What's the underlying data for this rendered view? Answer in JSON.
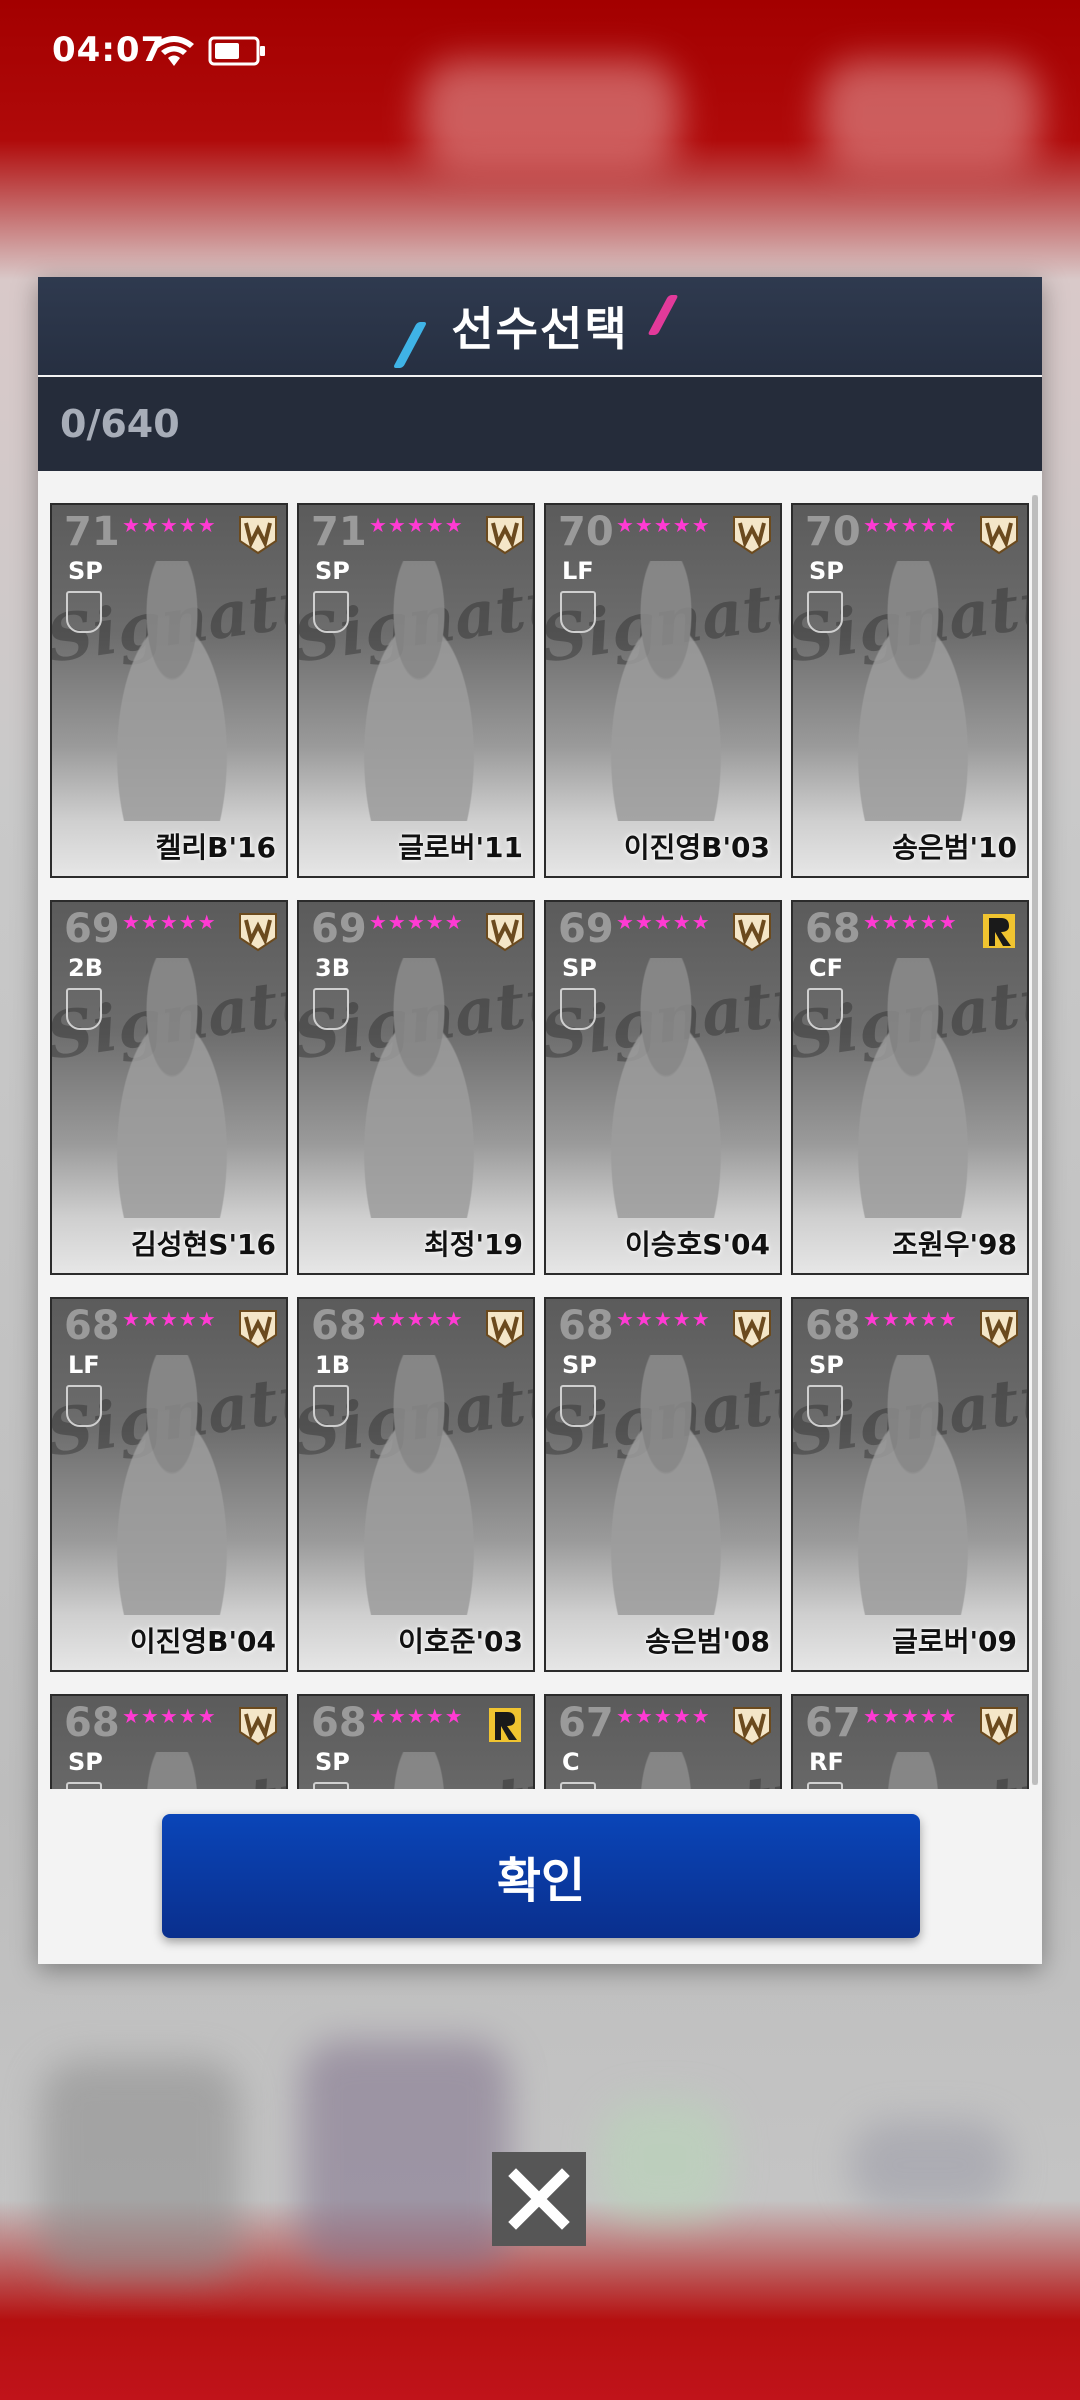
{
  "status_bar": {
    "time": "04:07"
  },
  "dialog": {
    "title": "선수선택",
    "counter": "0/640",
    "confirm_label": "확인",
    "signature_watermark": "Signature",
    "stars": "★★★★★"
  },
  "cards": [
    {
      "rating": "71",
      "position": "SP",
      "name": "켈리B'16",
      "team_logo": "W"
    },
    {
      "rating": "71",
      "position": "SP",
      "name": "글로버'11",
      "team_logo": "W"
    },
    {
      "rating": "70",
      "position": "LF",
      "name": "이진영B'03",
      "team_logo": "W"
    },
    {
      "rating": "70",
      "position": "SP",
      "name": "송은범'10",
      "team_logo": "W"
    },
    {
      "rating": "69",
      "position": "2B",
      "name": "김성현S'16",
      "team_logo": "W"
    },
    {
      "rating": "69",
      "position": "3B",
      "name": "최정'19",
      "team_logo": "W"
    },
    {
      "rating": "69",
      "position": "SP",
      "name": "이승호S'04",
      "team_logo": "W"
    },
    {
      "rating": "68",
      "position": "CF",
      "name": "조원우'98",
      "team_logo": "R"
    },
    {
      "rating": "68",
      "position": "LF",
      "name": "이진영B'04",
      "team_logo": "W"
    },
    {
      "rating": "68",
      "position": "1B",
      "name": "이호준'03",
      "team_logo": "W"
    },
    {
      "rating": "68",
      "position": "SP",
      "name": "송은범'08",
      "team_logo": "W"
    },
    {
      "rating": "68",
      "position": "SP",
      "name": "글로버'09",
      "team_logo": "W"
    },
    {
      "rating": "68",
      "position": "SP",
      "name": "",
      "team_logo": "W"
    },
    {
      "rating": "68",
      "position": "SP",
      "name": "",
      "team_logo": "R"
    },
    {
      "rating": "67",
      "position": "C",
      "name": "",
      "team_logo": "W"
    },
    {
      "rating": "67",
      "position": "RF",
      "name": "",
      "team_logo": "W"
    }
  ],
  "icons": {
    "wifi": "wifi-icon",
    "battery": "battery-icon",
    "close": "close-icon",
    "team_w": "wyverns-logo-icon",
    "team_r": "raiders-logo-icon"
  },
  "colors": {
    "header_bg": "#2f3a4f",
    "counter_bg": "#252c3a",
    "confirm_bg": "#0a45b8",
    "star": "#ff3ad3",
    "accent_blue": "#3fb3e6",
    "accent_pink": "#e23a9a"
  }
}
